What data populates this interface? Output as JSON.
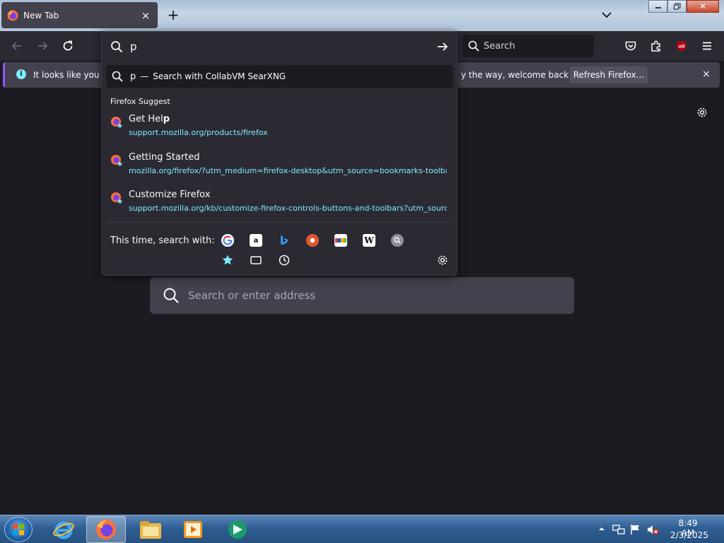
{
  "window": {
    "tab_title": "New Tab",
    "tab_close": "×",
    "new_tab": "+",
    "close_glyph": "✕"
  },
  "navbar": {
    "search_placeholder": "Search"
  },
  "infobar": {
    "text_start": "It looks like you ha",
    "text_end": "y the way, welcome back!",
    "refresh_label": "Refresh Firefox...",
    "close": "×"
  },
  "urlbar": {
    "value": "p",
    "first_row": {
      "query": "p",
      "separator": "—",
      "action": "Search with CollabVM SearXNG"
    },
    "group_label": "Firefox Suggest",
    "suggestions": [
      {
        "title_plain": "Get Hel",
        "title_bold": "p",
        "url": "support.mozilla.org/products/firefox"
      },
      {
        "title_plain": "Getting Started",
        "title_bold": "",
        "url": "mozilla.org/firefox/?utm_medium=firefox-desktop&utm_source=bookmarks-toolbar"
      },
      {
        "title_plain": "Customize Firefox",
        "title_bold": "",
        "url": "support.mozilla.org/kb/customize-firefox-controls-buttons-and-toolbars?utm_source"
      }
    ],
    "search_with_label": "This time, search with:",
    "engines": [
      "google-icon",
      "amazon-icon",
      "bing-icon",
      "duckduckgo-icon",
      "ebay-icon",
      "wikipedia-icon",
      "searxng-icon"
    ],
    "modes": [
      "bookmarks-icon",
      "tabs-icon",
      "history-icon"
    ]
  },
  "page": {
    "search_placeholder": "Search or enter address"
  },
  "taskbar": {
    "time": "8:49 AM",
    "date": "2/3/2025"
  },
  "colors": {
    "accent": "#80ebff",
    "panel": "#2b2a33",
    "background": "#1c1b22",
    "infobar_accent": "#9059ff"
  }
}
